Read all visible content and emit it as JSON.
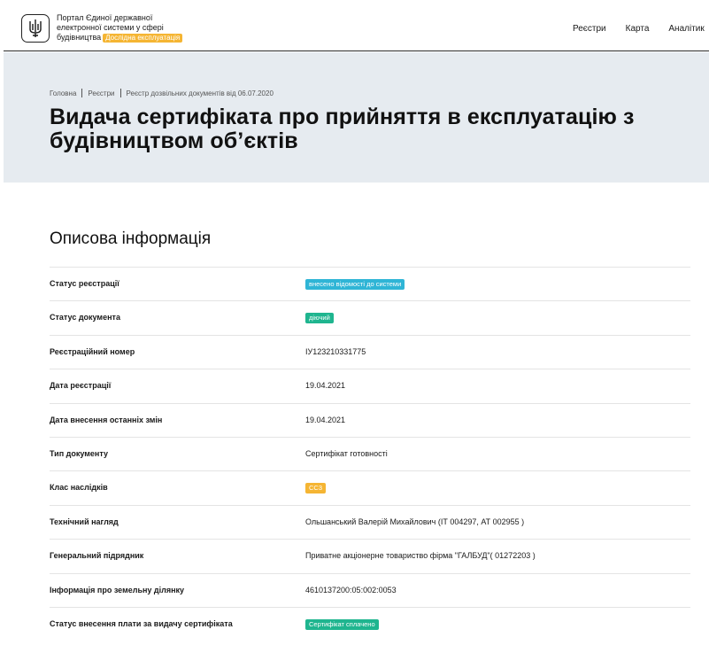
{
  "header": {
    "portal_line1": "Портал Єдиної державної",
    "portal_line2": "електронної системи у сфері",
    "portal_line3": "будівництва",
    "beta_badge": "Дослідна експлуатація",
    "nav": [
      "Реєстри",
      "Карта",
      "Аналітик"
    ]
  },
  "breadcrumb": [
    "Головна",
    "Реєстри",
    "Реєстр дозвільних документів від 06.07.2020"
  ],
  "page_title_line1": "Видача сертифіката про прийняття в експлуатацію з",
  "page_title_line2": "будівництвом об’єктів",
  "section_title": "Описова інформація",
  "colors": {
    "hero_bg": "#e6ebf0",
    "badge_blue": "#2fb5d6",
    "badge_green": "#1fb58f",
    "badge_orange": "#f5b533"
  },
  "rows": [
    {
      "label": "Статус реєстрації",
      "value": "внесено відомості до системи",
      "badge": "blue"
    },
    {
      "label": "Статус документа",
      "value": "діючий",
      "badge": "green"
    },
    {
      "label": "Реєстраційний номер",
      "value": "ІУ123210331775",
      "badge": ""
    },
    {
      "label": "Дата реєстрації",
      "value": "19.04.2021",
      "badge": ""
    },
    {
      "label": "Дата внесення останніх змін",
      "value": "19.04.2021",
      "badge": ""
    },
    {
      "label": "Тип документу",
      "value": "Сертифікат готовності",
      "badge": ""
    },
    {
      "label": "Клас наслідків",
      "value": "СС3",
      "badge": "orange"
    },
    {
      "label": "Технічний нагляд",
      "value": "Ольшанський Валерій Михайлович (ІТ 004297, АТ 002955 )",
      "badge": ""
    },
    {
      "label": "Генеральний підрядник",
      "value": "Приватне акціонерне товариство фірма \"ГАЛБУД\"( 01272203 )",
      "badge": ""
    },
    {
      "label": "Інформація про земельну ділянку",
      "value": "4610137200:05:002:0053",
      "badge": ""
    },
    {
      "label": "Статус внесення плати за видачу сертифіката",
      "value": "Сертифікат сплачено",
      "badge": "green"
    }
  ]
}
